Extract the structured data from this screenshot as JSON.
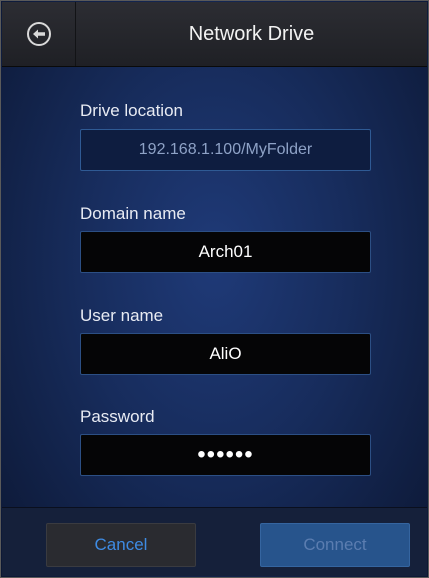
{
  "header": {
    "title": "Network Drive",
    "back_icon": "circle-arrow-left-icon"
  },
  "form": {
    "drive_location": {
      "label": "Drive location",
      "value": "192.168.1.100/MyFolder"
    },
    "domain_name": {
      "label": "Domain name",
      "value": "Arch01"
    },
    "user_name": {
      "label": "User name",
      "value": "AliO"
    },
    "password": {
      "label": "Password",
      "value": "••••••"
    }
  },
  "footer": {
    "cancel_label": "Cancel",
    "connect_label": "Connect"
  },
  "colors": {
    "accent_blue": "#3e8be3",
    "header_bg": "#2c2d33",
    "connect_bg": "#27548c"
  }
}
